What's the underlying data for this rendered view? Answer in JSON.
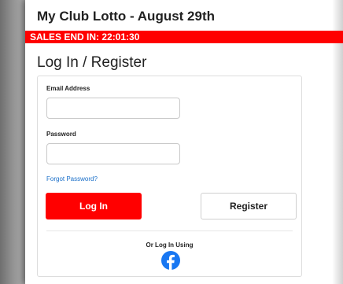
{
  "header": {
    "title": "My Club Lotto - August 29th",
    "sales_banner": "SALES END IN: 22:01:30",
    "banner_color": "#ff0000"
  },
  "login": {
    "section_title": "Log In / Register",
    "email_label": "Email Address",
    "email_value": "",
    "password_label": "Password",
    "password_value": "",
    "forgot_link": "Forgot Password?",
    "login_button": "Log In",
    "register_button": "Register",
    "social_label": "Or Log In Using",
    "social_icon": "facebook-icon",
    "facebook_color": "#1877f2",
    "link_color": "#1a6fc9"
  }
}
